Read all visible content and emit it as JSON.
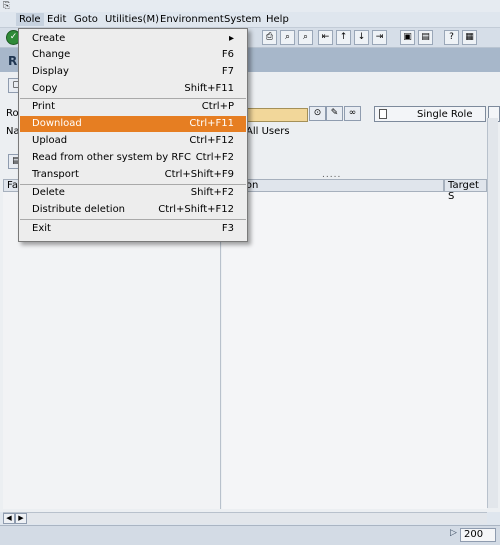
{
  "menubar": {
    "items": [
      {
        "label": "Role"
      },
      {
        "label": "Edit"
      },
      {
        "label": "Goto"
      },
      {
        "label": "Utilities(M)"
      },
      {
        "label": "Environment"
      },
      {
        "label": "System"
      },
      {
        "label": "Help"
      }
    ]
  },
  "title": {
    "text": "R"
  },
  "content": {
    "field_label_role": "Ro",
    "field_label_name": "Na",
    "col_left_label": "Fa",
    "col_description": "ription",
    "col_target": "Target S",
    "all_users_text": "All Users",
    "dots": ".....",
    "single_role_button": "Single Role"
  },
  "role_menu": {
    "items": [
      {
        "label": "Create",
        "shortcut": "▸"
      },
      {
        "label": "Change",
        "shortcut": "F6"
      },
      {
        "label": "Display",
        "shortcut": "F7"
      },
      {
        "label": "Copy",
        "shortcut": "Shift+F11"
      },
      {
        "label": "Print",
        "shortcut": "Ctrl+P"
      },
      {
        "label": "Download",
        "shortcut": "Ctrl+F11"
      },
      {
        "label": "Upload",
        "shortcut": "Ctrl+F12"
      },
      {
        "label": "Read from other system by RFC",
        "shortcut": "Ctrl+F2"
      },
      {
        "label": "Transport",
        "shortcut": "Ctrl+Shift+F9"
      },
      {
        "label": "Delete",
        "shortcut": "Shift+F2"
      },
      {
        "label": "Distribute deletion",
        "shortcut": "Ctrl+Shift+F12"
      },
      {
        "label": "Exit",
        "shortcut": "F3"
      }
    ],
    "highlight_color": "#e67e22"
  },
  "statusbar": {
    "value": "200"
  }
}
